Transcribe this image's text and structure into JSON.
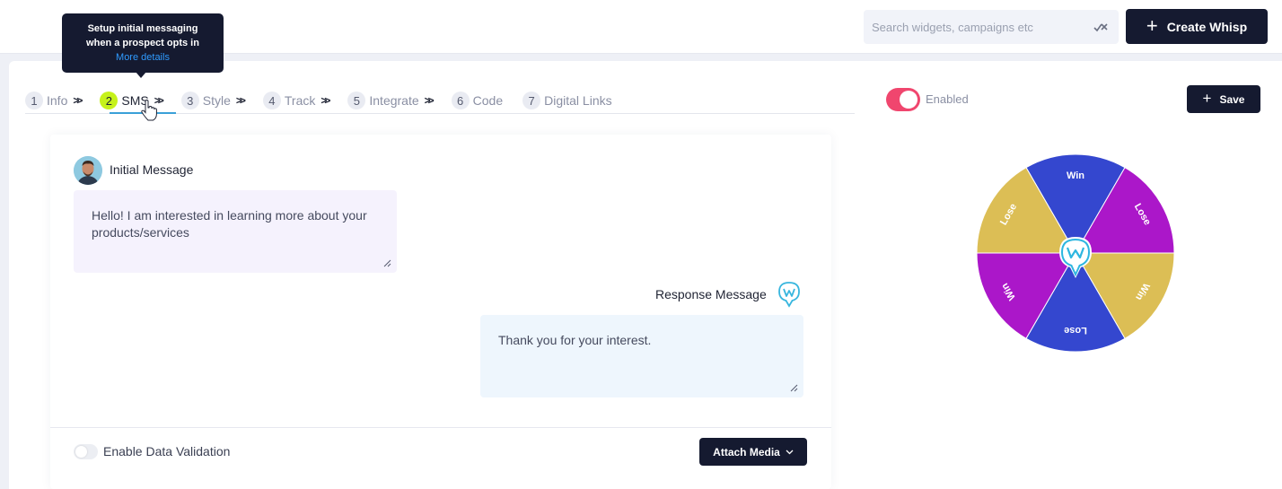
{
  "search": {
    "placeholder": "Search widgets, campaigns etc"
  },
  "header": {
    "create_label": "Create Whisp"
  },
  "tooltip": {
    "line1": "Setup initial messaging",
    "line2": "when a prospect opts in",
    "link": "More details"
  },
  "steps": [
    {
      "num": "1",
      "label": "Info",
      "active": false
    },
    {
      "num": "2",
      "label": "SMS",
      "active": true
    },
    {
      "num": "3",
      "label": "Style",
      "active": false
    },
    {
      "num": "4",
      "label": "Track",
      "active": false
    },
    {
      "num": "5",
      "label": "Integrate",
      "active": false
    },
    {
      "num": "6",
      "label": "Code",
      "active": false
    },
    {
      "num": "7",
      "label": "Digital Links",
      "active": false
    }
  ],
  "sms": {
    "initial_label": "Initial Message",
    "initial_text": "Hello! I am interested in learning more about your products/services",
    "response_label": "Response Message",
    "response_text": "Thank you for your interest.",
    "data_validation_label": "Enable Data Validation",
    "data_validation_enabled": false,
    "attach_label": "Attach Media"
  },
  "widget": {
    "enabled_label": "Enabled",
    "enabled": true,
    "save_label": "Save",
    "wheel": [
      {
        "label": "Win",
        "color": "#3447cf"
      },
      {
        "label": "Lose",
        "color": "#ab17c9"
      },
      {
        "label": "Win",
        "color": "#dcbe55"
      },
      {
        "label": "Lose",
        "color": "#3447cf"
      },
      {
        "label": "Win",
        "color": "#ab17c9"
      },
      {
        "label": "Lose",
        "color": "#dcbe55"
      }
    ]
  },
  "colors": {
    "accent": "#c6f21a",
    "toggle_on": "#f0466e",
    "dark_button": "#151a30"
  }
}
